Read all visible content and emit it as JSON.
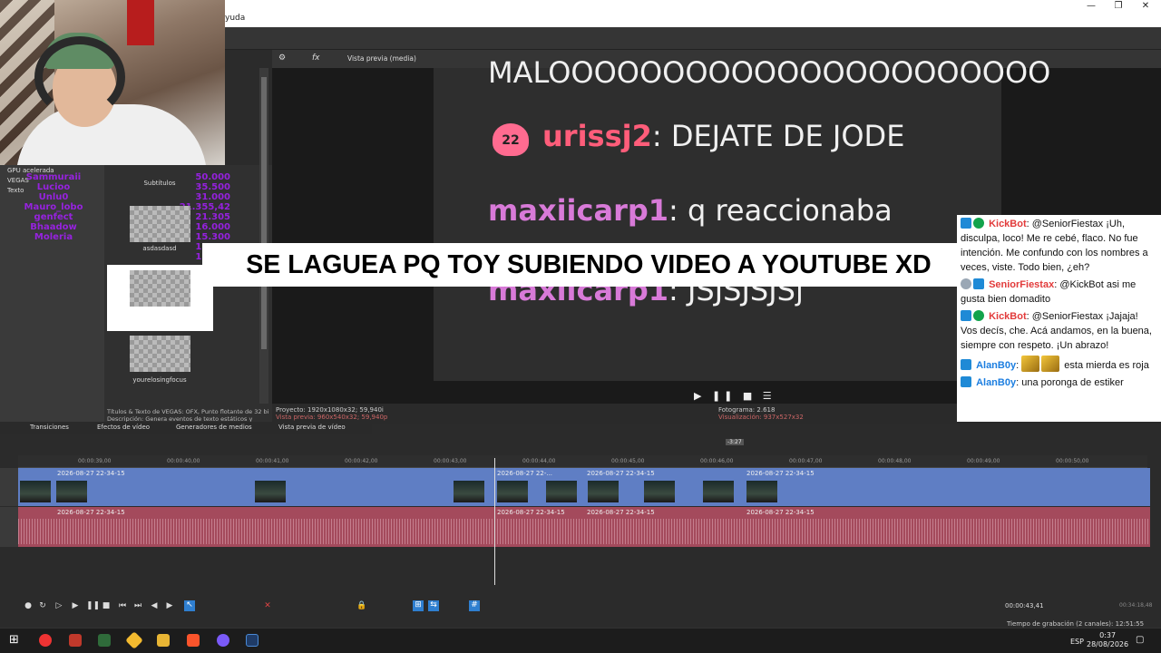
{
  "menu": {
    "partial_title": "yuda"
  },
  "window": {
    "minimize": "—",
    "restore": "❐",
    "close": "✕"
  },
  "explorer": {
    "tree": [
      "GPU acelerada",
      "VEGAS",
      "Texto"
    ],
    "overlay_names": [
      "Sammuraii",
      "Lucioo",
      "Unlu0",
      "Mauro_lobo",
      "genfect",
      "Bhaadow",
      "Moleria"
    ],
    "overlay_nums": [
      "50.000",
      "35.500",
      "31.000",
      "21.355,42",
      "21.305",
      "16.000",
      "15.300",
      "13.000",
      "12.365"
    ],
    "items": [
      "Subtítulos",
      "asdasdasd",
      "yourelosingfocus"
    ],
    "description": "Títulos & Texto de VEGAS: OFX, Punto flotante de 32 bi Descripción: Genera eventos de texto estáticos y anima",
    "tabs": [
      "Transiciones",
      "Efectos de vídeo",
      "Generadores de medios"
    ]
  },
  "preview": {
    "mode_label": "Vista previa (media)",
    "chat": [
      {
        "user": "",
        "msg": "MALOOOOOOOOOOOOOOOOOOOOOO"
      },
      {
        "badge": "22",
        "user": "urissj2",
        "msg": ": DEJATE DE JODE"
      },
      {
        "user": "maxiicarp1",
        "msg": ": q reaccionaba"
      },
      {
        "user": "maxiicarp1",
        "msg": ": JSJSJSJSj"
      }
    ],
    "controls": "▶ ❚❚ ■ ☰",
    "info_left": [
      "Proyecto:  1920x1080x32; 59,940i",
      "Vista previa:  960x540x32; 59,940p"
    ],
    "info_right": [
      "Fotograma:  2.618",
      "Visualización:  937x527x32"
    ],
    "tab": "Vista previa de vídeo"
  },
  "banner": {
    "text": "SE LAGUEA PQ TOY SUBIENDO VIDEO A YOUTUBE XD"
  },
  "kick_chat": [
    {
      "user": "KickBot",
      "user_color": "red",
      "icons": [
        "blue",
        "green"
      ],
      "msg": "@SeniorFiestax ¡Uh, disculpa, loco! Me re cebé, flaco. No fue intención. Me confundo con los nombres a veces, viste. Todo bien, ¿eh?"
    },
    {
      "user": "SeniorFiestax",
      "user_color": "red",
      "icons": [
        "gray",
        "blue"
      ],
      "msg": "@KickBot asi me gusta bien domadito"
    },
    {
      "user": "KickBot",
      "user_color": "red",
      "icons": [
        "blue",
        "green"
      ],
      "msg": "@SeniorFiestax ¡Jajaja! Vos decís, che. Acá andamos, en la buena, siempre con respeto. ¡Un abrazo!"
    },
    {
      "user": "AlanB0y",
      "user_color": "blue",
      "icons": [
        "blue"
      ],
      "emotes": 2,
      "msg": "esta mierda es roja"
    },
    {
      "user": "AlanB0y",
      "user_color": "blue",
      "icons": [
        "blue"
      ],
      "msg": "una poronga de estiker"
    }
  ],
  "timeline": {
    "ruler": [
      "00:00:39,00",
      "00:00:40,00",
      "00:00:41,00",
      "00:00:42,00",
      "00:00:43,00",
      "00:00:44,00",
      "00:00:45,00",
      "00:00:46,00",
      "00:00:47,00",
      "00:00:48,00",
      "00:00:49,00",
      "00:00:50,00"
    ],
    "clips": [
      "2026-08-27 22-34-15",
      "2026-08-27 22-...",
      "2026-08-27 22-34-15",
      "2026-08-27 22-34-15"
    ],
    "audio_clips": [
      "2026-08-27 22-34-15",
      "2026-08-27 22-34-15",
      "2026-08-27 22-34-15",
      "2026-08-27 22-34-15"
    ],
    "playhead_label": "-3:27",
    "timecode": "00:00:43,41",
    "timecode_end": "00:34:18,48",
    "record_time": "Tiempo de grabación (2 canales): 12:51:55"
  },
  "taskbar": {
    "lang": "ESP",
    "time": "0:37",
    "date": "28/08/2026"
  }
}
